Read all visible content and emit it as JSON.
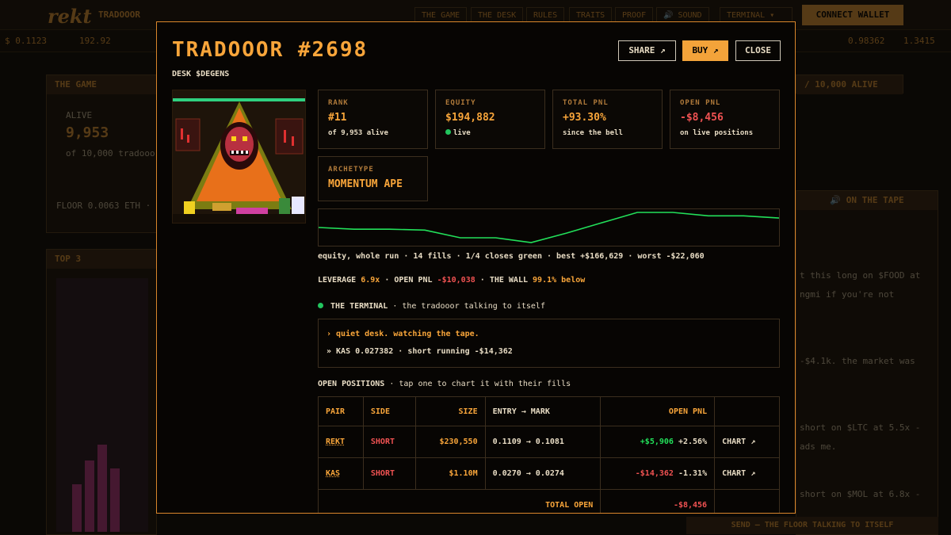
{
  "app": {
    "logo": "rekt",
    "brand": "TRADOOOR",
    "nav": [
      "THE GAME",
      "THE DESK",
      "RULES",
      "TRAITS",
      "PROOF",
      "🔊 SOUND",
      "TERMINAL"
    ],
    "connect_label": "CONNECT WALLET",
    "ticker": [
      "$ 0.1123",
      "192.92",
      "0.98362",
      "1.3415"
    ],
    "game_panel": {
      "header": "THE GAME",
      "alive_label": "ALIVE",
      "alive_value": "9,953",
      "alive_note": "of 10,000 tradooors",
      "floor": "FLOOR 0.0063 ETH · 24"
    },
    "top3_header": "TOP 3",
    "right_header": "/ 10,000 ALIVE",
    "tape_header": "🔊 ON THE TAPE",
    "feed": [
      "t this long on $FOOD at",
      "ngmi if you're not",
      "-$4.1k. the market was",
      "short on $LTC at 5.5x -",
      "ads me.",
      "short on $MOL at 6.8x -"
    ],
    "bottom_button": "SEND — THE FLOOR TALKING TO ITSELF"
  },
  "modal": {
    "title": "TRADOOOR #2698",
    "subtitle": "DESK $DEGENS",
    "share_label": "SHARE ↗",
    "buy_label": "BUY ↗",
    "close_label": "CLOSE",
    "stats": {
      "rank": {
        "label": "RANK",
        "value": "#11",
        "note": "of 9,953 alive"
      },
      "equity": {
        "label": "EQUITY",
        "value": "$194,882",
        "note": "live"
      },
      "total_pnl": {
        "label": "TOTAL PNL",
        "value": "+93.30%",
        "note": "since the bell"
      },
      "open_pnl": {
        "label": "OPEN PNL",
        "value": "-$8,456",
        "note": "on live positions"
      },
      "archetype": {
        "label": "ARCHETYPE",
        "value": "MOMENTUM APE"
      }
    },
    "equity_series": [
      194,
      190,
      190,
      188,
      170,
      170,
      159,
      181,
      205,
      229,
      229,
      221,
      221,
      216
    ],
    "equity_caption": "equity, whole run · 14 fills · 1/4 closes green · best +$166,629 · worst -$22,060",
    "leverage": {
      "label": "LEVERAGE",
      "value": "6.9x",
      "open_pnl_label": "· OPEN PNL",
      "open_pnl_value": "-$10,038",
      "wall_label": "· THE WALL",
      "wall_value": "99.1% below"
    },
    "terminal": {
      "heading": "THE TERMINAL",
      "sub": "· the tradooor talking to itself",
      "lines": [
        "› quiet desk. watching the tape.",
        "» KAS 0.027382 · short running -$14,362"
      ]
    },
    "positions": {
      "heading": "OPEN POSITIONS",
      "sub": "· tap one to chart it with their fills",
      "columns": [
        "PAIR",
        "SIDE",
        "SIZE",
        "ENTRY → MARK",
        "OPEN PNL",
        ""
      ],
      "rows": [
        {
          "pair": "REKT",
          "side": "SHORT",
          "size": "$230,550",
          "entry_mark": "0.1109 → 0.1081",
          "pnl": "+$5,906",
          "pnl_pct": "+2.56%",
          "action": "CHART ↗"
        },
        {
          "pair": "KAS",
          "side": "SHORT",
          "size": "$1.10M",
          "entry_mark": "0.0270 → 0.0274",
          "pnl": "-$14,362",
          "pnl_pct": "-1.31%",
          "action": "CHART ↗"
        }
      ],
      "total_label": "TOTAL OPEN",
      "total_value": "-$8,456"
    }
  },
  "colors": {
    "accent": "#f3a33a",
    "positive": "#22e05a",
    "negative": "#f05252",
    "border": "#d9862b"
  }
}
